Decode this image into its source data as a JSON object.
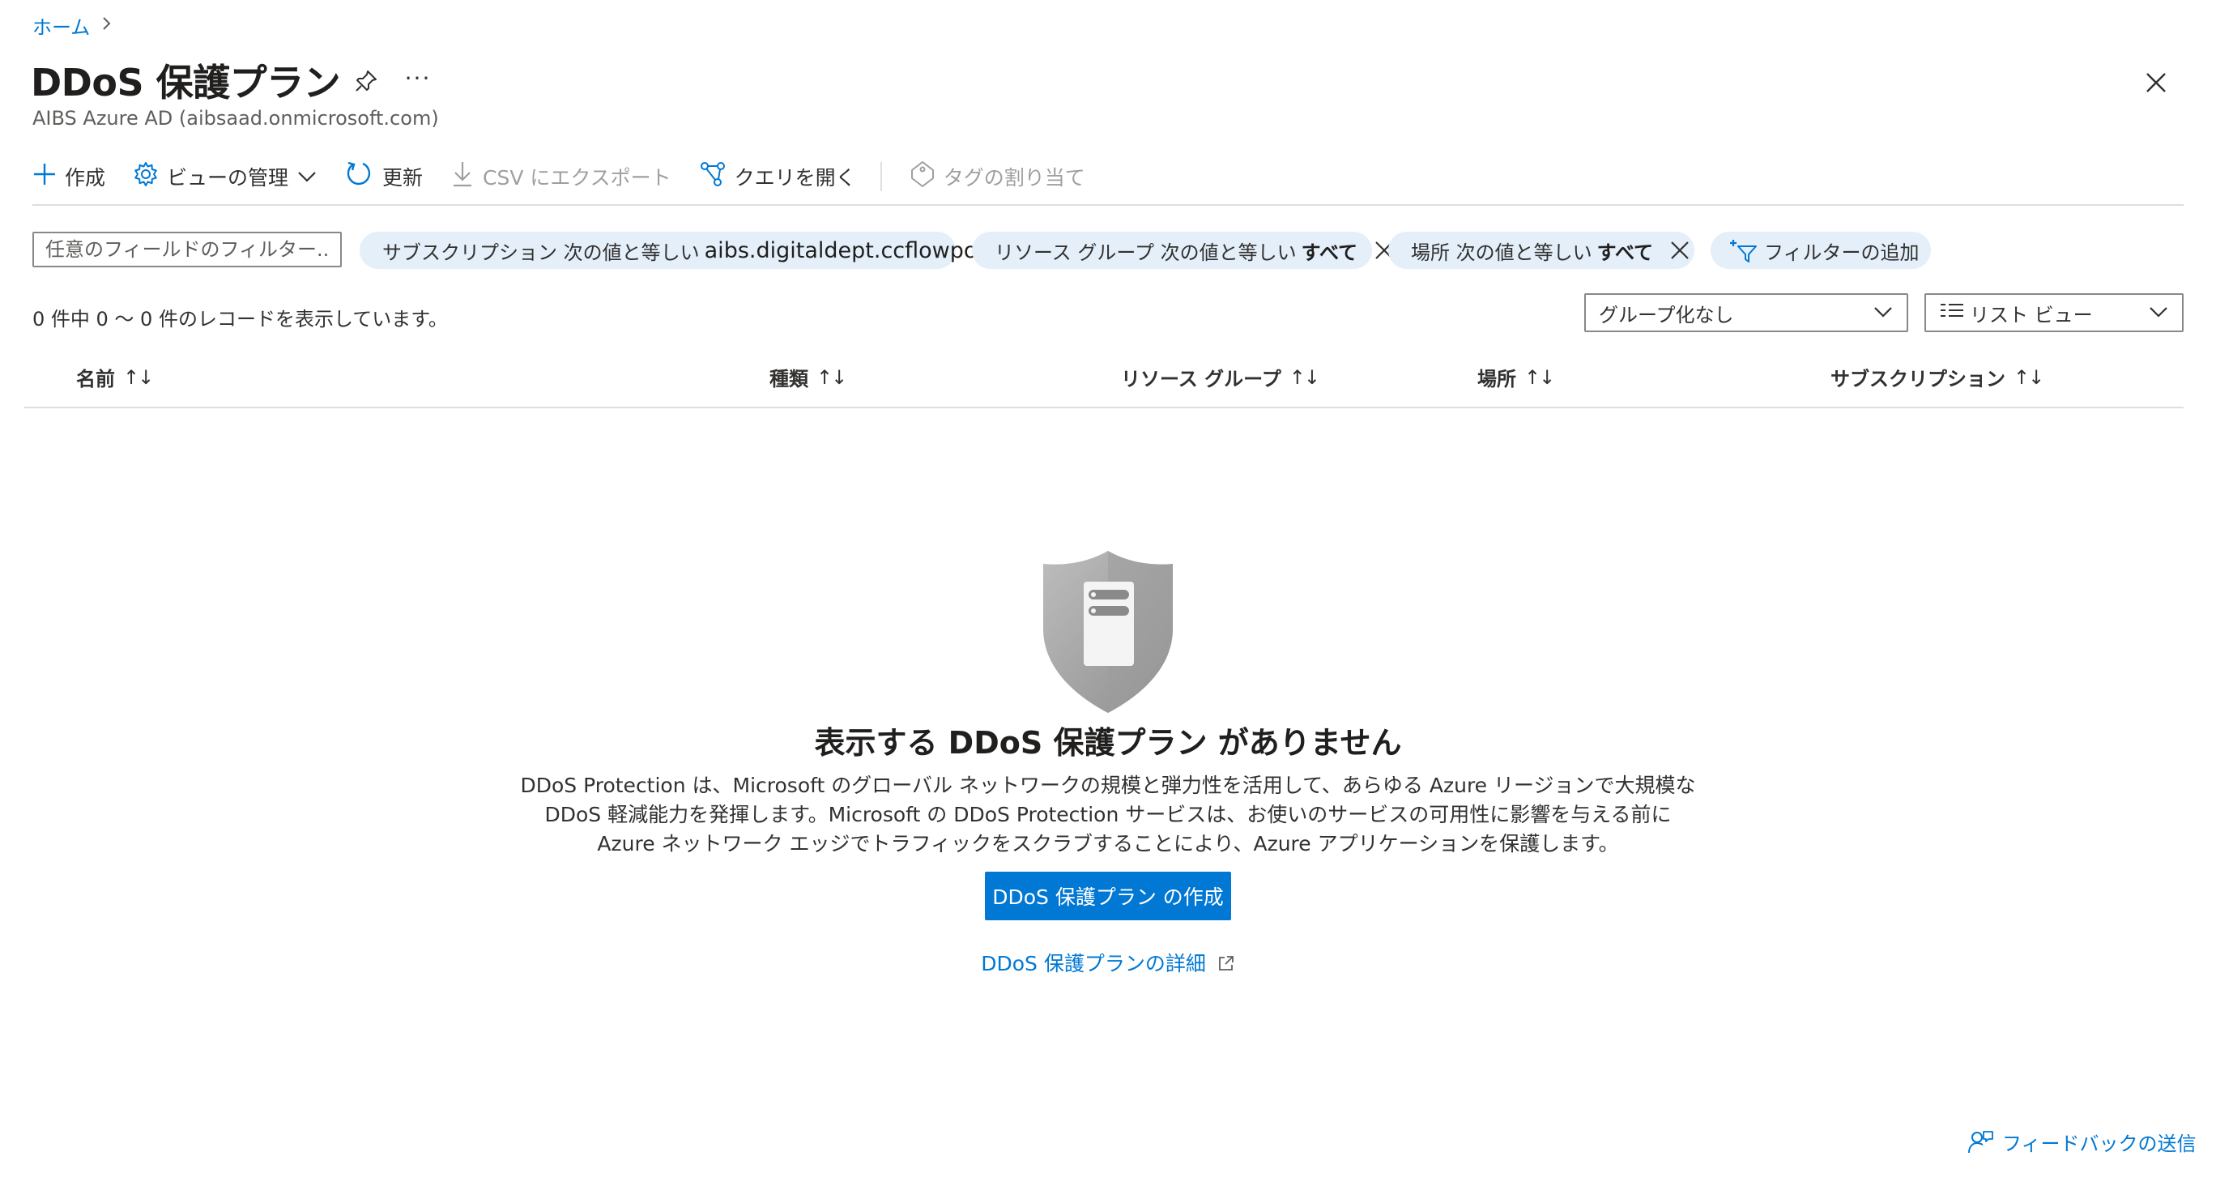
{
  "breadcrumb": {
    "home": "ホーム",
    "separator": ">"
  },
  "header": {
    "title": "DDoS 保護プラン",
    "subtitle": "AIBS Azure AD (aibsaad.onmicrosoft.com)",
    "more": "···"
  },
  "toolbar": {
    "create": "作成",
    "manage_view": "ビューの管理",
    "refresh": "更新",
    "export_csv": "CSV にエクスポート",
    "open_query": "クエリを開く",
    "assign_tags": "タグの割り当て"
  },
  "filters": {
    "search_placeholder": "任意のフィールドのフィルター...",
    "subscription": {
      "label": "サブスクリプション 次の値と等しい",
      "value": "aibs.digitaldept.ccflowpoc"
    },
    "resource_group": {
      "label": "リソース グループ 次の値と等しい",
      "value": "すべて"
    },
    "location": {
      "label": "場所 次の値と等しい",
      "value": "すべて"
    },
    "add_filter": "フィルターの追加"
  },
  "records": {
    "summary": "0 件中 0 ～ 0 件のレコードを表示しています。"
  },
  "grouping": {
    "selected": "グループ化なし"
  },
  "view_mode": {
    "selected": "リスト ビュー"
  },
  "table": {
    "columns": [
      "名前",
      "種類",
      "リソース グループ",
      "場所",
      "サブスクリプション"
    ],
    "sort_glyph": "↑↓",
    "rows": []
  },
  "empty_state": {
    "title": "表示する DDoS 保護プラン がありません",
    "description": [
      "DDoS Protection は、Microsoft のグローバル ネットワークの規模と弾力性を活用して、あらゆる Azure リージョンで大規模な",
      "DDoS 軽減能力を発揮します。Microsoft の DDoS Protection サービスは、お使いのサービスの可用性に影響を与える前に",
      "Azure ネットワーク エッジでトラフィックをスクラブすることにより、Azure アプリケーションを保護します。"
    ],
    "create_button": "DDoS 保護プラン の作成",
    "learn_more": "DDoS 保護プランの詳細"
  },
  "feedback": {
    "label": "フィードバックの送信"
  },
  "colors": {
    "accent": "#0078d4",
    "pill_bg": "#e4effa",
    "divider": "#e1dfdd",
    "shield": "#a8a8a8"
  },
  "icons": [
    "pin-icon",
    "more-icon",
    "close-icon",
    "plus-icon",
    "gear-icon",
    "chevron-down-icon",
    "refresh-icon",
    "download-icon",
    "query-icon",
    "tag-icon",
    "filter-add-icon",
    "list-icon",
    "shield-icon",
    "external-link-icon",
    "feedback-icon"
  ]
}
